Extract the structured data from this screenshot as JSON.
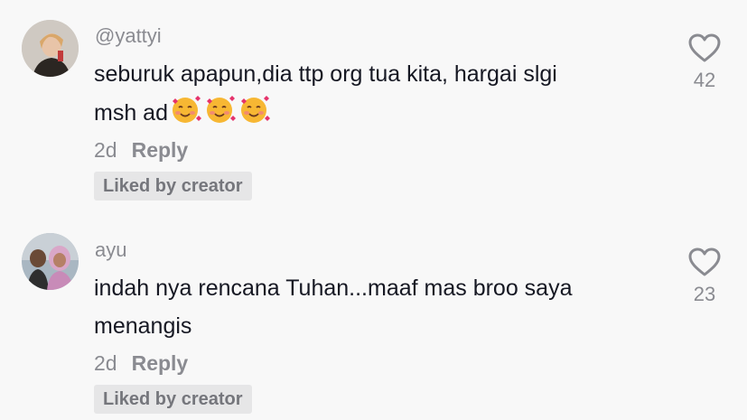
{
  "comments": [
    {
      "username": "@yattyi",
      "text": "seburuk apapun,dia ttp org tua kita, hargai slgi",
      "text_line2": "msh ad",
      "emojis": [
        "smiling-face-with-hearts",
        "smiling-face-with-hearts",
        "smiling-face-with-hearts"
      ],
      "time": "2d",
      "reply_label": "Reply",
      "badge": "Liked by creator",
      "likes": "42",
      "like_icon": "heart-outline-icon"
    },
    {
      "username": "ayu",
      "text": "indah nya rencana Tuhan...maaf mas broo saya",
      "text_line2": "menangis",
      "time": "2d",
      "reply_label": "Reply",
      "badge": "Liked by creator",
      "likes": "23",
      "like_icon": "heart-outline-icon"
    }
  ],
  "colors": {
    "background": "#f8f8f8",
    "text_primary": "#161823",
    "text_secondary": "#8a8b91",
    "badge_bg": "#e6e6e7"
  }
}
